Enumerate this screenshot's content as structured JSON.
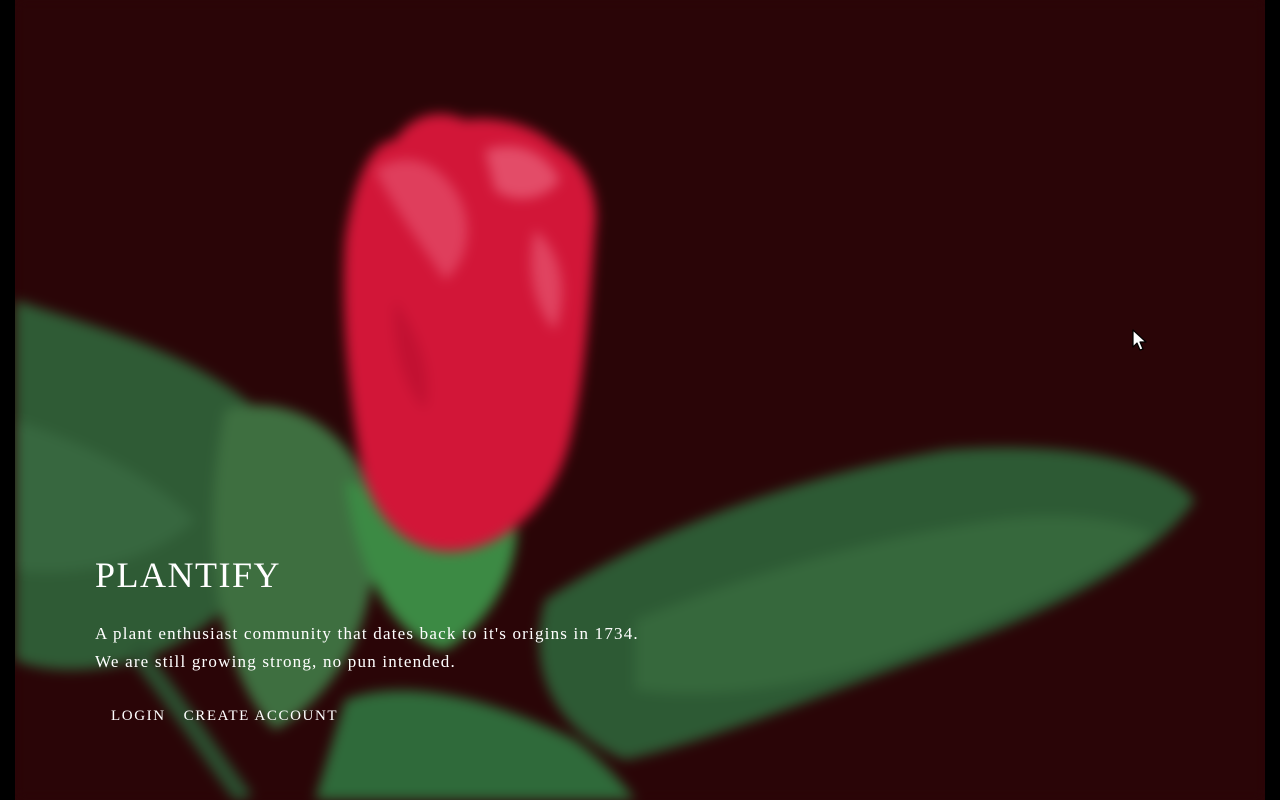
{
  "brand": {
    "title": "PLANTIFY"
  },
  "hero": {
    "tagline_line1": "A plant enthusiast community that dates back to it's origins in 1734.",
    "tagline_line2": "We are still growing strong, no pun intended."
  },
  "actions": {
    "login": "LOGIN",
    "create_account": "CREATE ACCOUNT"
  },
  "colors": {
    "background": "#2a0507",
    "flower": "#d21638",
    "leaf": "#2f6a3a",
    "text": "#ffffff"
  }
}
